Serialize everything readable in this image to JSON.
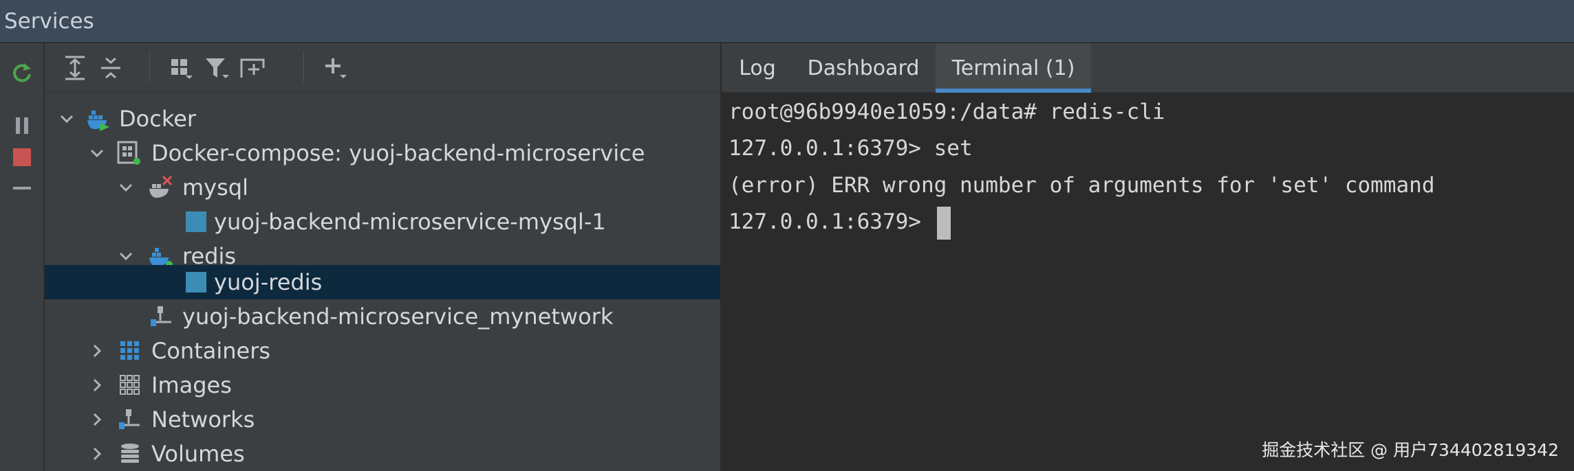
{
  "window": {
    "title": "Services"
  },
  "left_toolbar": {
    "icons": [
      "rerun-icon",
      "pause-icon",
      "stop-icon",
      "collapse-icon"
    ],
    "colors": {
      "rerun": "#4ea54e",
      "stop": "#c75450"
    }
  },
  "tree_toolbar": {
    "icons": [
      "expand-all-icon",
      "collapse-all-icon",
      "group-by-icon",
      "filter-icon",
      "new-tab-icon",
      "add-icon"
    ]
  },
  "tree": {
    "items": [
      {
        "label": "Docker",
        "icon": "docker-icon"
      },
      {
        "label": "Docker-compose: yuoj-backend-microservice",
        "icon": "compose-icon"
      },
      {
        "label": "mysql",
        "icon": "docker-service-error-icon"
      },
      {
        "label": "yuoj-backend-microservice-mysql-1",
        "icon": "container-icon"
      },
      {
        "label": "redis",
        "icon": "docker-service-running-icon"
      },
      {
        "label": "yuoj-redis",
        "icon": "container-icon",
        "selected": true
      },
      {
        "label": "yuoj-backend-microservice_mynetwork",
        "icon": "network-icon"
      },
      {
        "label": "Containers",
        "icon": "containers-icon"
      },
      {
        "label": "Images",
        "icon": "images-icon"
      },
      {
        "label": "Networks",
        "icon": "networks-icon"
      },
      {
        "label": "Volumes",
        "icon": "volumes-icon"
      }
    ]
  },
  "tabs": [
    {
      "label": "Log"
    },
    {
      "label": "Dashboard"
    },
    {
      "label": "Terminal (1)",
      "active": true
    }
  ],
  "terminal": {
    "lines": [
      "root@96b9940e1059:/data# redis-cli",
      "127.0.0.1:6379> set",
      "(error) ERR wrong number of arguments for 'set' command",
      "127.0.0.1:6379> "
    ]
  },
  "watermark": "掘金技术社区 @ 用户734402819342",
  "theme": {
    "selection": "#0d293e",
    "accent": "#4a88c7",
    "docker_blue": "#3a8fd6",
    "status_green": "#3fb950",
    "status_red": "#e05555"
  }
}
